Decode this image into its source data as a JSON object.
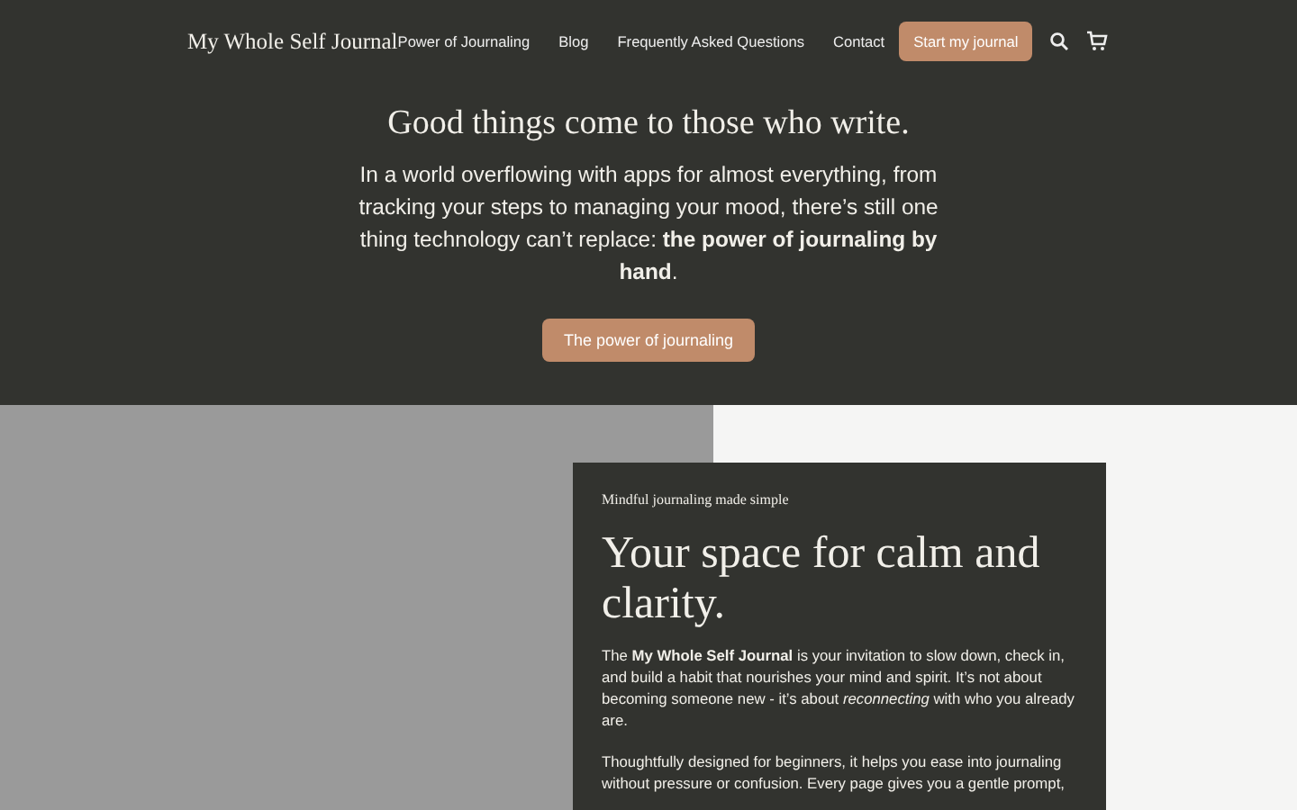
{
  "header": {
    "logo": "My Whole Self Journal",
    "nav": [
      {
        "label": "Power of Journaling"
      },
      {
        "label": "Blog"
      },
      {
        "label": "Frequently Asked Questions"
      },
      {
        "label": "Contact"
      }
    ],
    "cta": "Start my journal"
  },
  "hero": {
    "title": "Good things come to those who write.",
    "text": "In a world overflowing with apps for almost everything, from tracking your steps to managing your mood, there’s still one thing technology can’t replace: **the power of journaling by hand**.",
    "button": "The power of journaling"
  },
  "card": {
    "eyebrow": "Mindful journaling made simple",
    "title": "Your space for calm and clarity.",
    "paragraphs": [
      "The **My Whole Self Journal** is your invitation to slow down, check in, and build a habit that nourishes your mind and spirit. It’s not about becoming someone new - it’s about *reconnecting* with who you already are.",
      "Thoughtfully designed for beginners, it helps you ease into journaling without pressure or confusion. Every page gives you a gentle prompt,"
    ]
  }
}
